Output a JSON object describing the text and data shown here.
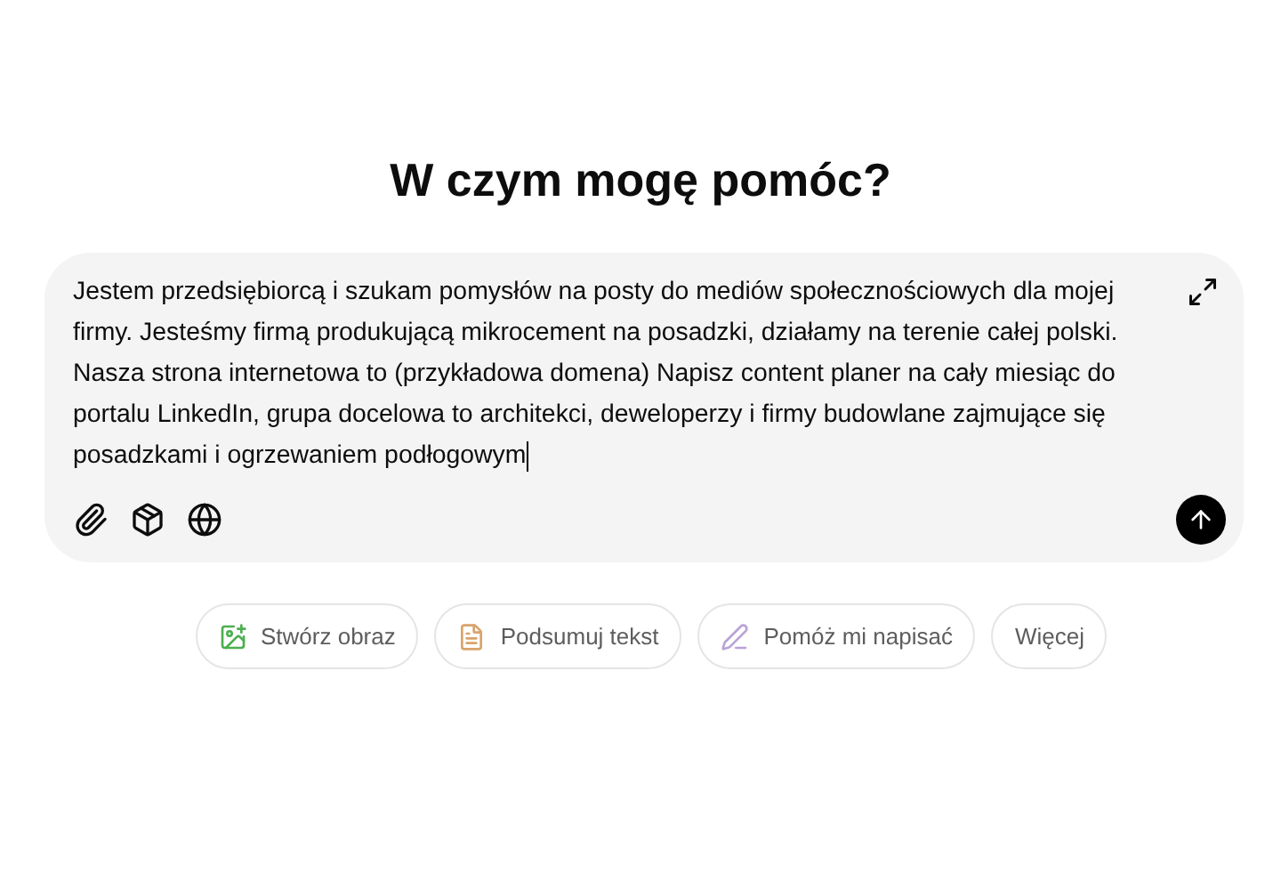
{
  "heading": "W czym mogę pomóc?",
  "composer": {
    "value": "Jestem przedsiębiorcą i szukam pomysłów na posty do mediów społecznościowych dla mojej firmy. Jesteśmy firmą produkującą mikrocement na posadzki, działamy na terenie całej polski. Nasza strona internetowa to (przykładowa domena) Napisz content planer na cały miesiąc do portalu LinkedIn, grupa docelowa to architekci, deweloperzy i firmy budowlane zajmujące się posadzkami i ogrzewaniem podłogowym"
  },
  "suggestions": [
    {
      "label": "Stwórz obraz",
      "kind": "image"
    },
    {
      "label": "Podsumuj tekst",
      "kind": "document"
    },
    {
      "label": "Pomóż mi napisać",
      "kind": "pen"
    },
    {
      "label": "Więcej",
      "kind": "plain"
    }
  ]
}
